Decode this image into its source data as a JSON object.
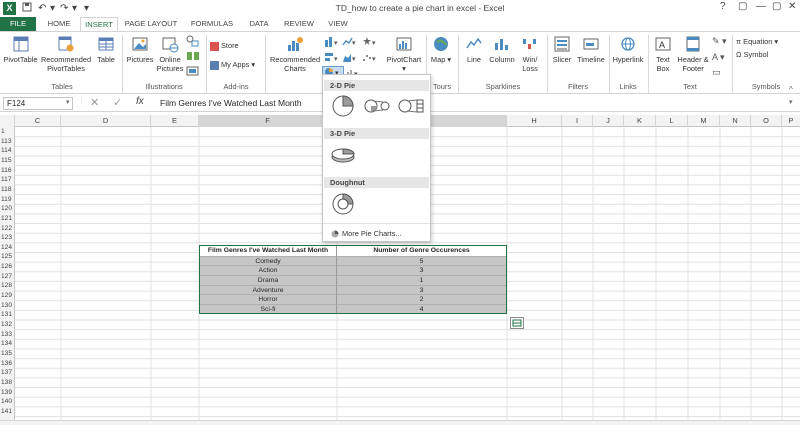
{
  "window": {
    "title": "TD_how to create a pie chart in excel - Excel",
    "controls": [
      "?",
      "▢",
      "—",
      "▢",
      "✕"
    ]
  },
  "tabs": [
    {
      "label": "FILE"
    },
    {
      "label": "HOME"
    },
    {
      "label": "INSERT"
    },
    {
      "label": "PAGE LAYOUT"
    },
    {
      "label": "FORMULAS"
    },
    {
      "label": "DATA"
    },
    {
      "label": "REVIEW"
    },
    {
      "label": "VIEW"
    }
  ],
  "ribbon": {
    "tables": {
      "label": "Tables",
      "pivottable": "PivotTable",
      "recommended": "Recommended PivotTables",
      "table": "Table"
    },
    "illustrations": {
      "label": "Illustrations",
      "pictures": "Pictures",
      "online": "Online Pictures"
    },
    "addins": {
      "label": "Add-ins",
      "store": "Store",
      "myapps": "My Apps"
    },
    "charts": {
      "recommended": "Recommended Charts",
      "pivotchart": "PivotChart"
    },
    "tours": {
      "label": "Tours",
      "map": "Map"
    },
    "sparklines": {
      "label": "Sparklines",
      "line": "Line",
      "column": "Column",
      "winloss": "Win/ Loss"
    },
    "filters": {
      "label": "Filters",
      "slicer": "Slicer",
      "timeline": "Timeline"
    },
    "links": {
      "label": "Links",
      "hyperlink": "Hyperlink"
    },
    "text": {
      "label": "Text",
      "textbox": "Text Box",
      "header": "Header & Footer"
    },
    "symbols": {
      "label": "Symbols",
      "equation": "Equation",
      "symbol": "Symbol"
    }
  },
  "formula_bar": {
    "name_box": "F124",
    "content": "Film Genres I've Watched Last Month"
  },
  "columns": [
    "C",
    "D",
    "E",
    "F",
    "H",
    "I",
    "J",
    "K",
    "L",
    "M",
    "N",
    "O",
    "P"
  ],
  "rows": [
    "1",
    "113",
    "114",
    "115",
    "116",
    "117",
    "118",
    "119",
    "120",
    "121",
    "122",
    "123",
    "124",
    "125",
    "126",
    "127",
    "128",
    "129",
    "130",
    "131",
    "132",
    "133",
    "134",
    "135",
    "136",
    "137",
    "138",
    "139",
    "140",
    "141"
  ],
  "table": {
    "headers": [
      "Film Genres I've Watched Last Month",
      "Number of Genre Occurences"
    ],
    "rows": [
      [
        "Comedy",
        "5"
      ],
      [
        "Action",
        "3"
      ],
      [
        "Drama",
        "1"
      ],
      [
        "Adventure",
        "3"
      ],
      [
        "Horror",
        "2"
      ],
      [
        "Sci-fi",
        "4"
      ]
    ]
  },
  "pie_menu": {
    "section_2d": "2-D Pie",
    "section_3d": "3-D Pie",
    "section_doughnut": "Doughnut",
    "more": "More Pie Charts..."
  },
  "colors": {
    "excel_green": "#217346",
    "selection_fill": "#c6c6c6"
  }
}
